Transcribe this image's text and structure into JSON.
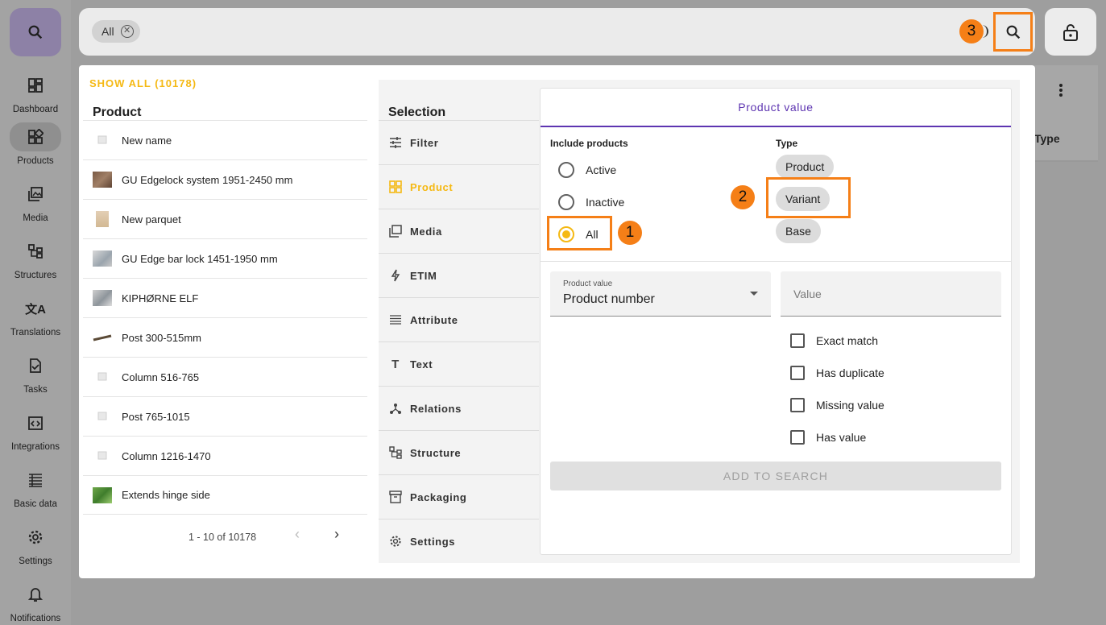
{
  "nav": {
    "items": [
      {
        "label": "Dashboard",
        "icon": "dashboard-icon"
      },
      {
        "label": "Products",
        "icon": "products-icon"
      },
      {
        "label": "Media",
        "icon": "media-icon"
      },
      {
        "label": "Structures",
        "icon": "structures-icon"
      },
      {
        "label": "Translations",
        "icon": "translate-icon"
      },
      {
        "label": "Tasks",
        "icon": "tasks-icon"
      },
      {
        "label": "Integrations",
        "icon": "integrations-icon"
      },
      {
        "label": "Basic data",
        "icon": "basic-data-icon"
      },
      {
        "label": "Settings",
        "icon": "gear-icon"
      },
      {
        "label": "Notifications",
        "icon": "bell-icon"
      }
    ],
    "active": "Products"
  },
  "search": {
    "chip": "All"
  },
  "annotations": {
    "one": "1",
    "two": "2",
    "three": "3",
    "color": "#f57f17"
  },
  "background": {
    "type_header": "Type"
  },
  "product_panel": {
    "show_all": "SHOW ALL (10178)",
    "title": "Product",
    "rows": [
      "New name",
      "GU Edgelock system 1951-2450 mm",
      "New parquet",
      "GU Edge bar lock 1451-1950 mm",
      "KIPHØRNE ELF",
      "Post 300-515mm",
      "Column 516-765",
      "Post 765-1015",
      "Column 1216-1470",
      "Extends hinge side"
    ],
    "pagination": "1 - 10 of 10178"
  },
  "selection": {
    "title": "Selection",
    "items": [
      "Filter",
      "Product",
      "Media",
      "ETIM",
      "Attribute",
      "Text",
      "Relations",
      "Structure",
      "Packaging",
      "Settings"
    ],
    "active": "Product",
    "accent": "#f5b914"
  },
  "product_value": {
    "tab": "Product value",
    "include_label": "Include products",
    "include_options": [
      "Active",
      "Inactive",
      "All"
    ],
    "include_selected": "All",
    "type_label": "Type",
    "type_options": [
      "Product",
      "Variant",
      "Base"
    ],
    "field_label": "Product value",
    "field_value": "Product number",
    "value_placeholder": "Value",
    "checks": [
      "Exact match",
      "Has duplicate",
      "Missing value",
      "Has value"
    ],
    "add_button": "ADD TO SEARCH",
    "tab_color": "#5e35b1"
  }
}
